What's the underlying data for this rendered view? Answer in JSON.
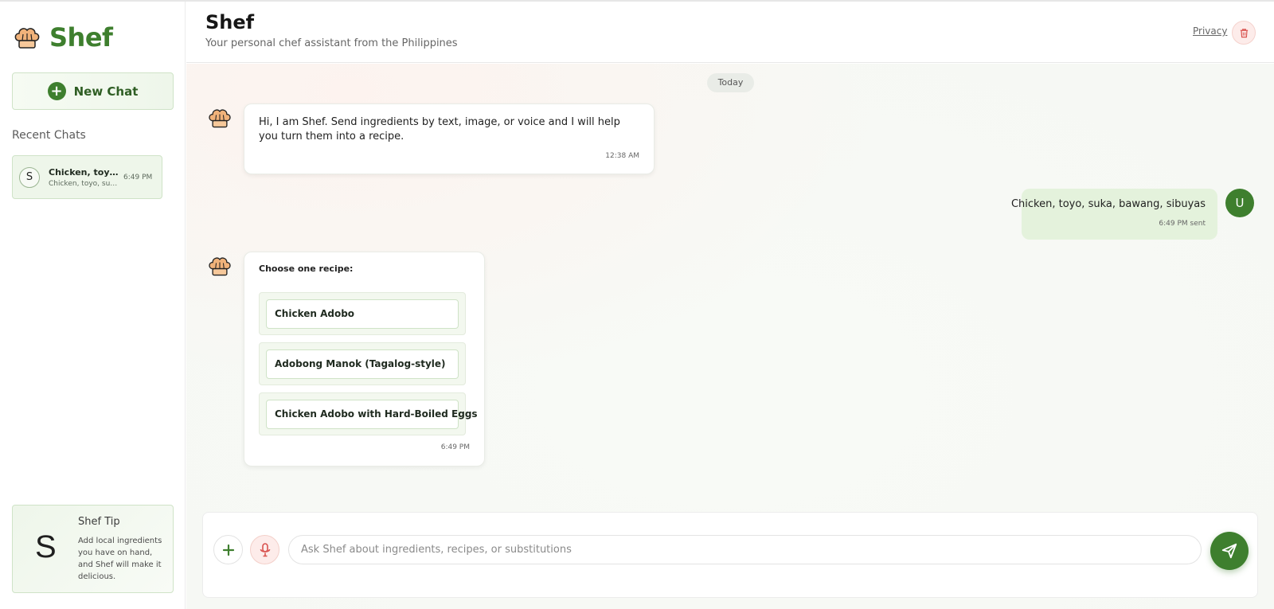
{
  "app": {
    "name": "Shef",
    "title": "Shef",
    "subtitle": "Your personal chef assistant from the Philippines",
    "accent_color": "#3e7f2e"
  },
  "sidebar": {
    "new_chat_label": "New Chat",
    "recent_title": "Recent Chats",
    "recent_chats": [
      {
        "avatar": "S",
        "title": "Chicken, toyo, suka, bawang, sibuyas",
        "preview": "Chicken, toyo, suka, bawang, sibuyas",
        "time": "6:49 PM"
      }
    ],
    "tip": {
      "letter": "S",
      "title": "Shef Tip",
      "body": "Add local ingredients you have on hand, and Shef will make it delicious."
    }
  },
  "header": {
    "privacy_label": "Privacy",
    "trash_icon": "trash-icon"
  },
  "chat": {
    "day_label": "Today",
    "messages": [
      {
        "sender": "bot",
        "text": "Hi, I am Shef. Send ingredients by text, image, or voice and I will help you turn them into a recipe.",
        "time": "12:38 AM"
      },
      {
        "sender": "user",
        "avatar": "U",
        "text": "Chicken, toyo, suka, bawang, sibuyas",
        "time": "6:49 PM sent"
      },
      {
        "sender": "bot",
        "label": "Choose one recipe:",
        "options": [
          "Chicken Adobo",
          "Adobong Manok (Tagalog-style)",
          "Chicken Adobo with Hard-Boiled Eggs"
        ],
        "time": "6:49 PM"
      }
    ]
  },
  "composer": {
    "placeholder": "Ask Shef about ingredients, recipes, or substitutions",
    "value": "",
    "icons": [
      "plus-icon",
      "microphone-icon",
      "send-icon"
    ]
  }
}
